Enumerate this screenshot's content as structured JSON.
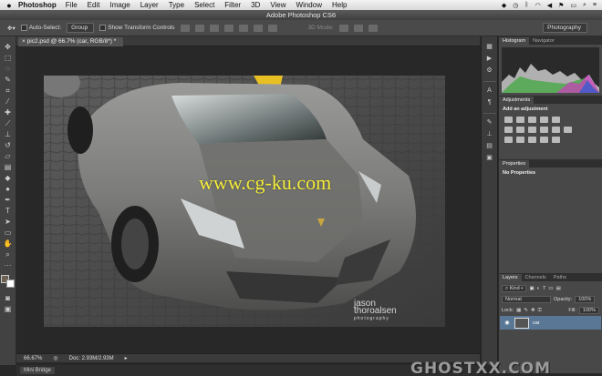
{
  "menubar": {
    "apple": "",
    "app_name": "Photoshop",
    "items": [
      "File",
      "Edit",
      "Image",
      "Layer",
      "Type",
      "Select",
      "Filter",
      "3D",
      "View",
      "Window",
      "Help"
    ],
    "status_icons": [
      "dropbox-icon",
      "clock-icon",
      "bluetooth-icon",
      "wifi-icon",
      "volume-icon",
      "flag-icon",
      "battery-icon",
      "search-icon",
      "list-icon"
    ]
  },
  "titlebar": {
    "title": "Adobe Photoshop CS6"
  },
  "options": {
    "auto_select_label": "Auto-Select:",
    "auto_select_value": "Group",
    "transform_label": "Show Transform Controls",
    "mode_label": "3D Mode:",
    "workspace": "Photography"
  },
  "document": {
    "tab_label": "pic2.psd @ 66.7% (car, RGB/8*) *",
    "zoom": "66.67%",
    "doc_info": "Doc: 2.93M/2.93M",
    "signature_line1": "jason",
    "signature_line2": "thoroalsen",
    "signature_line3": "photography"
  },
  "minibridge": {
    "label": "Mini Bridge"
  },
  "panels": {
    "histogram_tabs": [
      "Histogram",
      "Navigator"
    ],
    "adjustments_tab": "Adjustments",
    "adjustments_title": "Add an adjustment",
    "properties_tab": "Properties",
    "properties_text": "No Properties",
    "layers_tabs": [
      "Layers",
      "Channels",
      "Paths"
    ],
    "kind_label": "Kind",
    "blend_mode": "Normal",
    "opacity_label": "Opacity:",
    "opacity_value": "100%",
    "lock_label": "Lock:",
    "fill_label": "Fill:",
    "fill_value": "100%",
    "layer_name": "car"
  },
  "watermarks": {
    "center": "www.cg-ku.com",
    "corner": "GHOSTXX.COM"
  },
  "colors": {
    "foreground": "#6c6153",
    "background": "#ffffff",
    "layer_selected": "#5a7895",
    "watermark_yellow": "#f5ee3a"
  }
}
